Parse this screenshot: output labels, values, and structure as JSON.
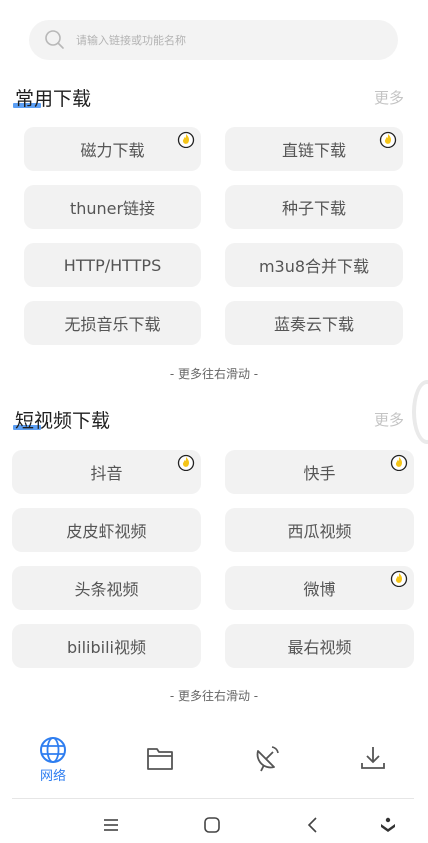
{
  "search": {
    "placeholder": "请输入链接或功能名称"
  },
  "sections": [
    {
      "title": "常用下载",
      "more": "更多",
      "items": [
        {
          "label": "磁力下载",
          "hot": true
        },
        {
          "label": "直链下载",
          "hot": true
        },
        {
          "label": "thuner链接",
          "hot": false
        },
        {
          "label": "种子下载",
          "hot": false
        },
        {
          "label": "HTTP/HTTPS",
          "hot": false
        },
        {
          "label": "m3u8合并下载",
          "hot": false
        },
        {
          "label": "无损音乐下载",
          "hot": false
        },
        {
          "label": "蓝奏云下载",
          "hot": false
        }
      ],
      "hint": "- 更多往右滑动 -"
    },
    {
      "title": "短视频下载",
      "more": "更多",
      "items": [
        {
          "label": "抖音",
          "hot": true
        },
        {
          "label": "快手",
          "hot": true
        },
        {
          "label": "皮皮虾视频",
          "hot": false
        },
        {
          "label": "西瓜视频",
          "hot": false
        },
        {
          "label": "头条视频",
          "hot": false
        },
        {
          "label": "微博",
          "hot": true
        },
        {
          "label": "bilibili视频",
          "hot": false
        },
        {
          "label": "最右视频",
          "hot": false
        }
      ],
      "hint": "- 更多往右滑动 -"
    }
  ],
  "tabbar": {
    "active_label": "网络",
    "tabs": [
      {
        "icon": "globe-icon",
        "label": "网络",
        "active": true
      },
      {
        "icon": "folder-icon",
        "active": false
      },
      {
        "icon": "satellite-dish-icon",
        "active": false
      },
      {
        "icon": "download-icon",
        "active": false
      }
    ]
  },
  "colors": {
    "accent": "#2f7ef0",
    "button_bg": "#f2f2f2",
    "hot_badge": "#f5c518"
  }
}
